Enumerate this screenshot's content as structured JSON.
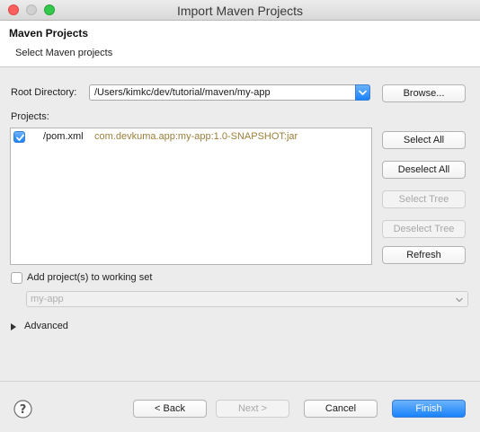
{
  "window": {
    "title": "Import Maven Projects"
  },
  "header": {
    "title": "Maven Projects",
    "subtitle": "Select Maven projects"
  },
  "root_directory": {
    "label": "Root Directory:",
    "value": "/Users/kimkc/dev/tutorial/maven/my-app",
    "browse_label": "Browse..."
  },
  "projects": {
    "label": "Projects:",
    "items": [
      {
        "checked": true,
        "path": "/pom.xml",
        "artifact": "com.devkuma.app:my-app:1.0-SNAPSHOT:jar"
      }
    ]
  },
  "side_buttons": {
    "select_all": "Select All",
    "deselect_all": "Deselect All",
    "select_tree": "Select Tree",
    "deselect_tree": "Deselect Tree",
    "refresh": "Refresh"
  },
  "working_set": {
    "checked": false,
    "label": "Add project(s) to working set",
    "value": "my-app"
  },
  "advanced": {
    "label": "Advanced"
  },
  "footer": {
    "back": "< Back",
    "next": "Next >",
    "cancel": "Cancel",
    "finish": "Finish"
  },
  "colors": {
    "accent": "#1a82fb",
    "artifact_text": "#9c7f3a"
  }
}
